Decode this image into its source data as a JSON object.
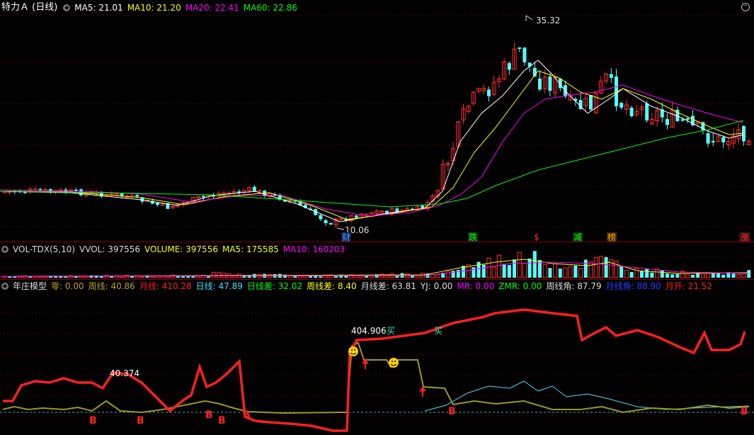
{
  "main_panel": {
    "title": "特力Ａ (日线)",
    "indicators": [
      {
        "label": "MA5: 21.01",
        "color": "#ffffff"
      },
      {
        "label": "MA10: 21.20",
        "color": "#ffff00"
      },
      {
        "label": "MA20: 22.41",
        "color": "#ff00ff"
      },
      {
        "label": "MA60: 22.86",
        "color": "#00ff00"
      }
    ],
    "high_label": "35.32",
    "low_label": "10.06",
    "markers": [
      {
        "text": "财",
        "color": "#4aa3ff"
      },
      {
        "text": "跌",
        "color": "#00ff00"
      },
      {
        "text": "$",
        "color": "#ff3030"
      },
      {
        "text": "减",
        "color": "#00ff00"
      },
      {
        "text": "榜",
        "color": "#ffa500"
      },
      {
        "text": "涨",
        "color": "#ff3030"
      }
    ]
  },
  "volume_panel": {
    "name": "VOL-TDX(5,10)",
    "indicators": [
      {
        "label": "VVOL: 397556",
        "color": "#dddddd"
      },
      {
        "label": "VOLUME: 397556",
        "color": "#ffff00"
      },
      {
        "label": "MA5: 175585",
        "color": "#ffff00"
      },
      {
        "label": "MA10: 160203",
        "color": "#ff00ff"
      }
    ]
  },
  "model_panel": {
    "name": "年庄模型",
    "indicators": [
      {
        "label": "零: 0.00",
        "color": "#b8a030"
      },
      {
        "label": "周线: 40.86",
        "color": "#b8a030"
      },
      {
        "label": "月线: 410.28",
        "color": "#ff2020"
      },
      {
        "label": "日线: 47.89",
        "color": "#40e0ff"
      },
      {
        "label": "日线差: 32.02",
        "color": "#00ff00"
      },
      {
        "label": "周线差: 8.40",
        "color": "#ffff00"
      },
      {
        "label": "月线差: 63.81",
        "color": "#dddddd"
      },
      {
        "label": "YJ: 0.00",
        "color": "#dddddd"
      },
      {
        "label": "MR: 0.00",
        "color": "#ff00ff"
      },
      {
        "label": "ZMR: 0.00",
        "color": "#00ff00"
      },
      {
        "label": "周线角: 87.79",
        "color": "#dddddd"
      },
      {
        "label": "月线角: 88.90",
        "color": "#2040ff"
      },
      {
        "label": "月开: 21.52",
        "color": "#ff2020"
      }
    ],
    "value_label_1": "40.374",
    "value_label_2": "404.906",
    "buy_label": "买",
    "b_label": "B"
  },
  "colors": {
    "up": "#ff3030",
    "down": "#54ffff",
    "grid": "#8b0000"
  }
}
